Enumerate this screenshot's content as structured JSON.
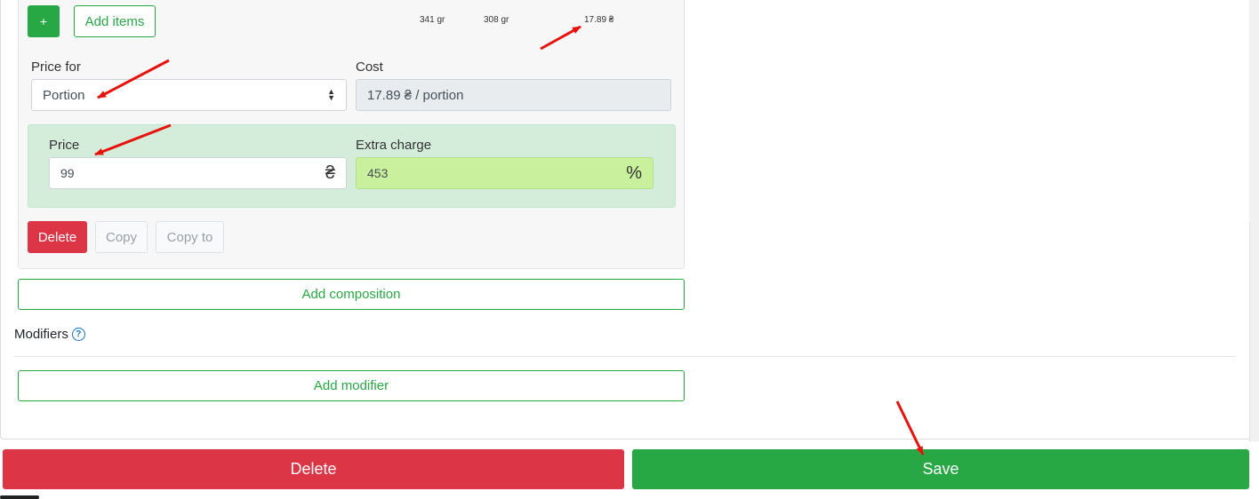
{
  "composition": {
    "plus_label": "+",
    "add_items_label": "Add items",
    "summary": {
      "gross_weight": "341 gr",
      "net_weight": "308 gr",
      "cost": "17.89 ₴"
    },
    "price_for": {
      "label": "Price for",
      "value": "Portion"
    },
    "cost": {
      "label": "Cost",
      "value": "17.89 ₴ / portion"
    },
    "price": {
      "label": "Price",
      "value": "99",
      "unit": "₴"
    },
    "extra_charge": {
      "label": "Extra charge",
      "value": "453",
      "unit": "%"
    },
    "delete_label": "Delete",
    "copy_label": "Copy",
    "copy_to_label": "Copy to"
  },
  "add_composition_label": "Add composition",
  "modifiers": {
    "title": "Modifiers",
    "help_icon": "question-circle-icon",
    "add_label": "Add modifier"
  },
  "footer": {
    "delete_label": "Delete",
    "save_label": "Save"
  },
  "colors": {
    "success": "#28a745",
    "danger": "#dc3545",
    "annotation": "#e8120c",
    "help": "#1a73c6"
  }
}
